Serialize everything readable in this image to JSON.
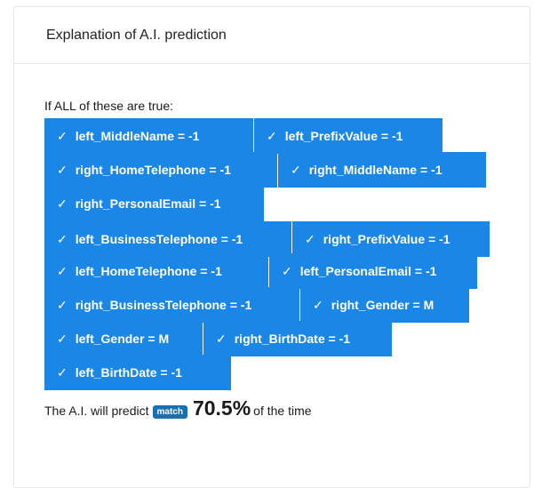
{
  "panel": {
    "title": "Explanation of A.I. prediction"
  },
  "intro_text": "If ALL of these are true:",
  "check_icon": "checkmark-icon",
  "accent_color": "#1a87e6",
  "conditions": [
    "left_MiddleName = -1",
    "left_PrefixValue = -1",
    "right_HomeTelephone = -1",
    "right_MiddleName = -1",
    "right_PersonalEmail = -1",
    "left_BusinessTelephone = -1",
    "right_PrefixValue = -1",
    "left_HomeTelephone = -1",
    "left_PersonalEmail = -1",
    "right_BusinessTelephone = -1",
    "right_Gender = M",
    "left_Gender = M",
    "right_BirthDate = -1",
    "left_BirthDate = -1"
  ],
  "result": {
    "prefix": "The A.I. will predict",
    "label": "match",
    "percent": "70.5%",
    "suffix": "of the time"
  }
}
